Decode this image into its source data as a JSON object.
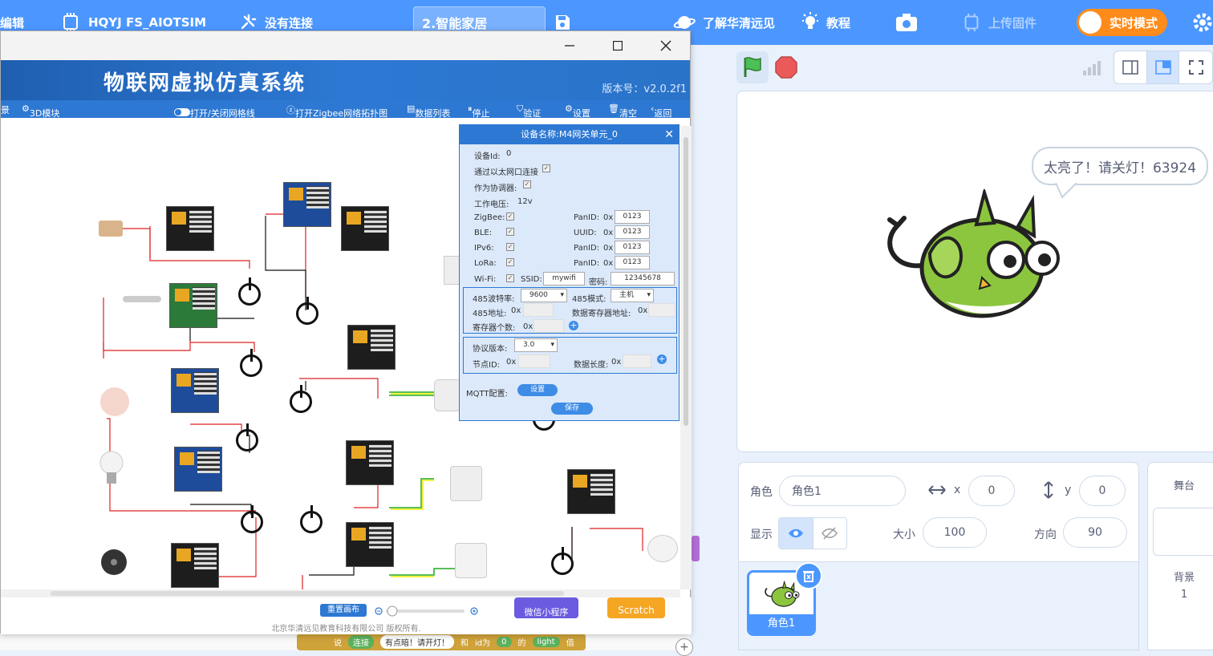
{
  "menubar": {
    "edit_label": "编辑",
    "device_label": "HQYJ FS_AIOTSIM",
    "connection_label": "没有连接",
    "project_title": "2.智能家居",
    "learn_label": "了解华清远见",
    "tutorial_label": "教程",
    "upload_label": "上传固件",
    "realtime_label": "实时模式",
    "accent_color": "#4c97ff",
    "toggle_color": "#ff8c1a"
  },
  "sim": {
    "title": "物联网虚拟仿真系统",
    "version": "版本号：v2.0.2f1",
    "toolbar": {
      "item_partial": "景",
      "module_3d": "3D模块",
      "grid_toggle": "打开/关闭网格线",
      "zigbee_topology": "打开Zigbee网络拓扑图",
      "data_list": "数据列表",
      "stop": "停止",
      "verify": "验证",
      "settings": "设置",
      "clear": "清空",
      "back": "返回"
    },
    "bottom": {
      "reset_canvas": "重置画布",
      "wechat": "微信小程序",
      "scratch": "Scratch",
      "copyright": "北京华清远见教育科技有限公司 版权所有."
    }
  },
  "device_dialog": {
    "title": "设备名称:M4网关单元_0",
    "device_id_label": "设备Id:",
    "device_id": "0",
    "ethernet_label": "通过以太网口连接",
    "coordinator_label": "作为协调器:",
    "voltage_label": "工作电压:",
    "voltage": "12v",
    "zigbee_label": "ZigBee:",
    "ble_label": "BLE:",
    "ipv6_label": "IPv6:",
    "lora_label": "LoRa:",
    "wifi_label": "Wi-Fi:",
    "panid_label": "PanID:",
    "uuid_label": "UUID:",
    "hex_prefix": "0x",
    "zigbee_panid": "0123",
    "ble_uuid": "0123",
    "ipv6_panid": "0123",
    "lora_panid": "0123",
    "ssid_label": "SSID:",
    "ssid": "mywifi",
    "password_label": "密码:",
    "password": "12345678",
    "baud_label": "485波特率:",
    "baud": "9600",
    "mode_label": "485模式:",
    "mode": "主机",
    "addr_label": "485地址:",
    "data_reg_label": "数据寄存器地址:",
    "reg_count_label": "寄存器个数:",
    "protocol_label": "协议版本:",
    "protocol": "3.0",
    "node_id_label": "节点ID:",
    "data_len_label": "数据长度:",
    "mqtt_label": "MQTT配置:",
    "mqtt_button": "设置",
    "save_button": "保存"
  },
  "stage": {
    "speech": "太亮了！请关灯！63924"
  },
  "sprite_info": {
    "sprite_label": "角色",
    "sprite_name": "角色1",
    "x_label": "x",
    "x": "0",
    "y_label": "y",
    "y": "0",
    "show_label": "显示",
    "size_label": "大小",
    "size": "100",
    "direction_label": "方向",
    "direction": "90"
  },
  "sprites": [
    {
      "name": "角色1"
    }
  ],
  "stage_pane": {
    "title": "舞台",
    "backdrop_label": "背景",
    "backdrop_count": "1"
  },
  "code_block": {
    "say": "说",
    "join": "连接",
    "text": "有点暗！请开灯！",
    "and": "和",
    "id_label": "id为",
    "id_value": "0",
    "of": "的",
    "prop": "light",
    "value": "值"
  }
}
